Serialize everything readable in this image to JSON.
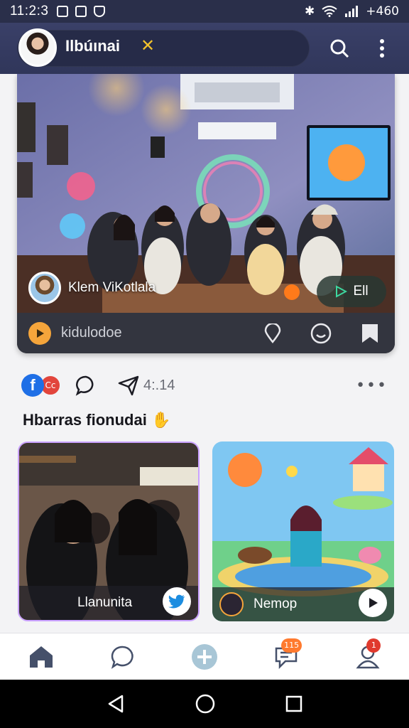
{
  "status_bar": {
    "time": "11:2:3",
    "battery": "+460"
  },
  "header": {
    "title": "Ilbúınai",
    "title_suffix": "ʚ"
  },
  "post": {
    "author_name": "Klem ViKotlala",
    "play_label": "Ell",
    "bar_label": "kidulodoe"
  },
  "actions": {
    "badge_letter": "f",
    "badge_count": "Cc",
    "share_count": "4:.14",
    "more": "•••"
  },
  "section": {
    "title": "Hbarras fionudai"
  },
  "tiles": [
    {
      "title": "Llanunita"
    },
    {
      "title": "Nemop"
    }
  ],
  "bottom_nav": {
    "messages_badge": "115",
    "profile_badge": "1"
  },
  "colors": {
    "accent_orange": "#f5a53b",
    "header_bg": "#30365a",
    "facebook_blue": "#1f6fe6"
  }
}
